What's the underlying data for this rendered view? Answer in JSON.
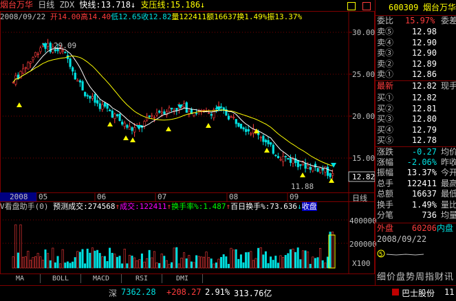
{
  "header": {
    "name": "烟台万华",
    "period": "日线",
    "ma_label": "ZDX",
    "fast_line": "快线:13.718",
    "arrow_down": "↓",
    "slow_line": "支压线:15.186",
    "arrow_down2": "↓"
  },
  "ohlc": {
    "date": "2008/09/22",
    "open": "开14.00",
    "high": "高14.40",
    "low": "低12.65",
    "close": "收12.82",
    "volume": "量122411",
    "amount": "额16637",
    "turnover": "换1.49%",
    "amplitude": "振13.37%"
  },
  "price_axis": [
    "30.00",
    "25.00",
    "20.00",
    "15.00"
  ],
  "price_marker": "12.82",
  "peak_label": "29.09",
  "trough_label": "11.88",
  "date_axis": [
    "2008",
    "05",
    "06",
    "07",
    "08",
    "09"
  ],
  "date_axis_right": "日线",
  "volume_header": {
    "title": "V看盘助手(0)",
    "forecast": "预测成交:274568",
    "arrow_up": "↑",
    "volume": "成交:122411",
    "arrow_up2": "↑",
    "turnover": "换手率%:1.487",
    "arrow_up3": "↑",
    "hundred": "百日换手%:73.636",
    "arrow_down": "↓",
    "extra": "收盘"
  },
  "volume_axis": [
    "400000",
    "200000"
  ],
  "volume_unit": "X100",
  "indicator_tabs": [
    "MA",
    "BOLL",
    "MACD",
    "RSI",
    "DMI"
  ],
  "quote": {
    "code": "600309",
    "name": "烟台万华",
    "wb_label": "委比",
    "wb_value": "15.97%",
    "wc_label": "委差",
    "sells": [
      {
        "label": "卖⑤",
        "price": "12.98"
      },
      {
        "label": "卖④",
        "price": "12.90"
      },
      {
        "label": "卖③",
        "price": "12.90"
      },
      {
        "label": "卖②",
        "price": "12.89"
      },
      {
        "label": "卖①",
        "price": "12.86"
      }
    ],
    "last_label": "最新",
    "last_price": "12.82",
    "last_extra": "现手",
    "buys": [
      {
        "label": "买①",
        "price": "12.82"
      },
      {
        "label": "买②",
        "price": "12.81"
      },
      {
        "label": "买③",
        "price": "12.80"
      },
      {
        "label": "买④",
        "price": "12.79"
      },
      {
        "label": "买⑤",
        "price": "12.78"
      }
    ],
    "stats": [
      {
        "label": "涨跌",
        "value": "-0.27",
        "extra": "均价",
        "color": "#00e0e0"
      },
      {
        "label": "涨幅",
        "value": "-2.06%",
        "extra": "昨收",
        "color": "#00e0e0"
      },
      {
        "label": "振幅",
        "value": "13.37%",
        "extra": "今开",
        "color": "#ffffff"
      },
      {
        "label": "总手",
        "value": "122411",
        "extra": "最高",
        "color": "#ffffff"
      },
      {
        "label": "总额",
        "value": "16637",
        "extra": "最低",
        "color": "#ffffff"
      },
      {
        "label": "换手",
        "value": "1.49%",
        "extra": "量比",
        "color": "#ffffff"
      },
      {
        "label": "分笔",
        "value": "736",
        "extra": "均量",
        "color": "#ffffff"
      }
    ],
    "outer_label": "外盘",
    "outer_value": "60206",
    "inner_label": "内盘",
    "mini_date": "2008/09/22",
    "bottom_tabs": "细价盘势周指财讯"
  },
  "status": {
    "market": "深",
    "index": "7362.28",
    "change": "+208.27",
    "pct": "2.91%",
    "amount": "313.76亿",
    "bus_label": "巴士股份",
    "bus_value": "11"
  },
  "colors": {
    "up": "#ff3c3c",
    "down": "#00e0e0",
    "ma_fast": "#ffffff",
    "ma_slow": "#ffff00",
    "grid": "#800000"
  }
}
